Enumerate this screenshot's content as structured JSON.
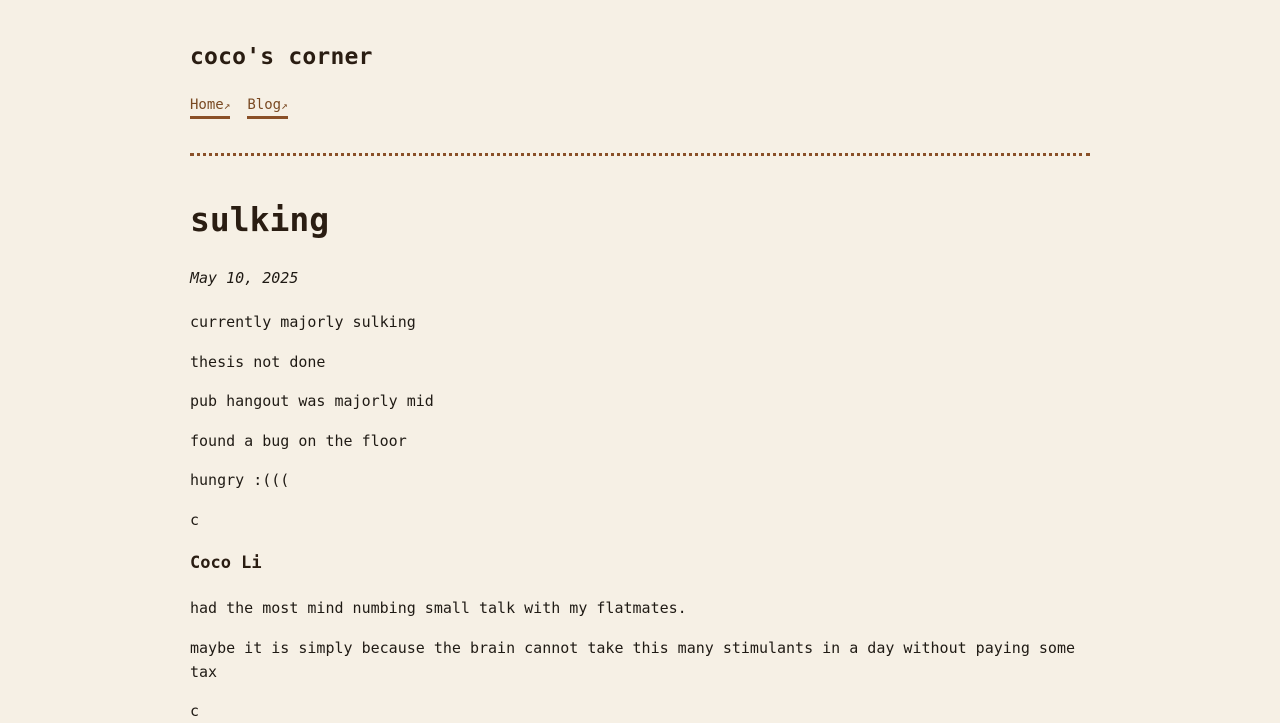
{
  "site": {
    "title": "coco's corner",
    "nav": [
      {
        "label": "Home",
        "arrow": "↗"
      },
      {
        "label": "Blog",
        "arrow": "↗"
      }
    ]
  },
  "post": {
    "title": "sulking",
    "date": "May 10, 2025",
    "lines": [
      "currently majorly sulking",
      "thesis not done",
      "pub hangout was majorly mid",
      "found a bug on the floor",
      "hungry :(((",
      "c"
    ]
  },
  "section2": {
    "heading": "Coco Li",
    "lines": [
      "had the most mind numbing small talk with my flatmates.",
      "maybe it is simply because the brain cannot take this many stimulants in a day without paying some tax",
      "c"
    ]
  },
  "colors": {
    "background": "#f6f0e5",
    "accent": "#8a5028",
    "text": "#1f1a14"
  }
}
